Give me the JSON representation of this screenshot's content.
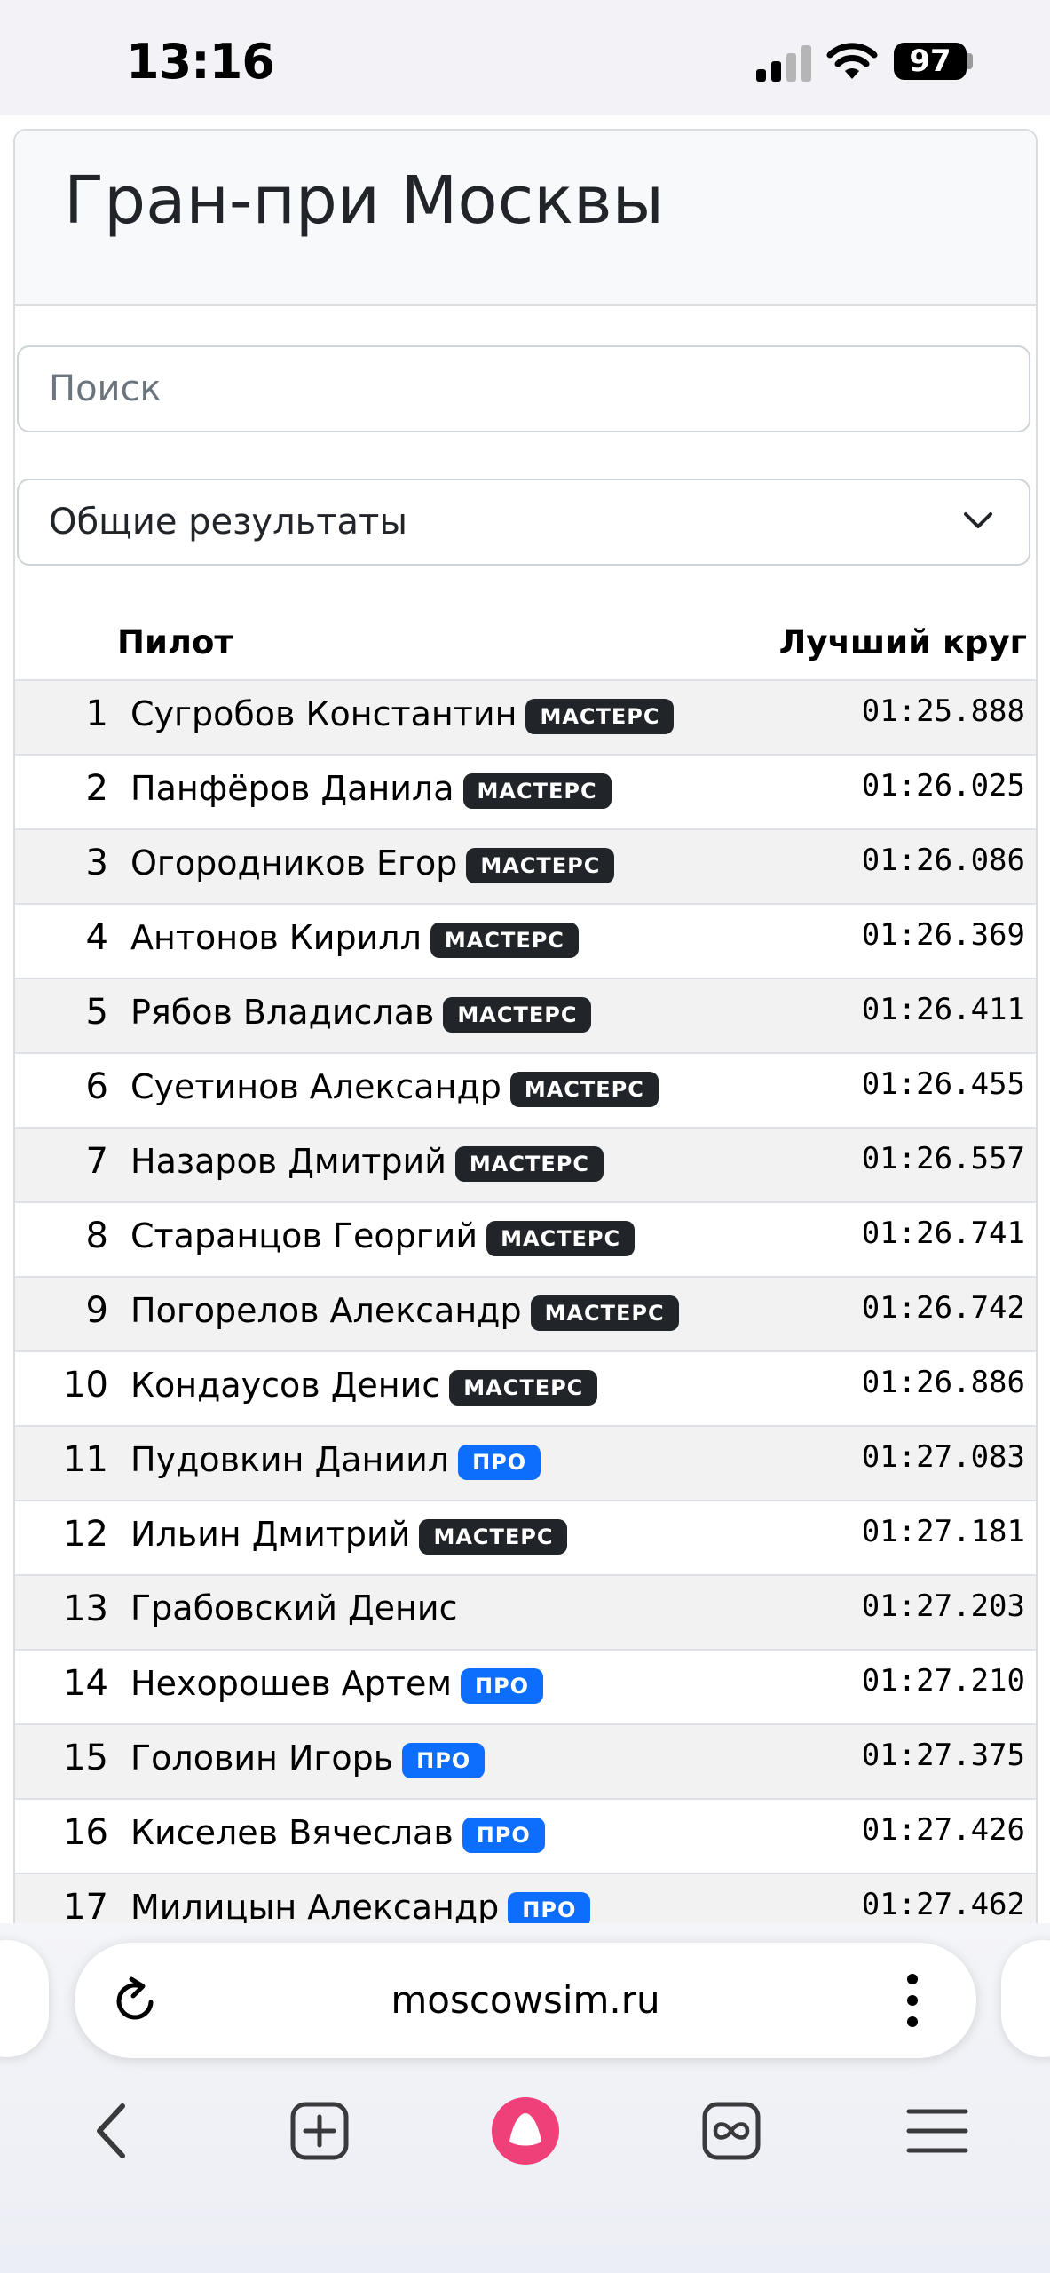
{
  "status_bar": {
    "time": "13:16",
    "battery": "97"
  },
  "page": {
    "title": "Гран-при Москвы"
  },
  "search": {
    "placeholder": "Поиск"
  },
  "filter": {
    "selected": "Общие результаты"
  },
  "table": {
    "headers": {
      "pilot": "Пилот",
      "best_lap": "Лучший круг"
    },
    "rows": [
      {
        "pos": "1",
        "name": "Сугробов Константин",
        "badge": "МАСТЕРС",
        "badge_type": "masters",
        "time": "01:25.888"
      },
      {
        "pos": "2",
        "name": "Панфёров Данила",
        "badge": "МАСТЕРС",
        "badge_type": "masters",
        "time": "01:26.025"
      },
      {
        "pos": "3",
        "name": "Огородников Егор",
        "badge": "МАСТЕРС",
        "badge_type": "masters",
        "time": "01:26.086"
      },
      {
        "pos": "4",
        "name": "Антонов Кирилл",
        "badge": "МАСТЕРС",
        "badge_type": "masters",
        "time": "01:26.369"
      },
      {
        "pos": "5",
        "name": "Рябов Владислав",
        "badge": "МАСТЕРС",
        "badge_type": "masters",
        "time": "01:26.411"
      },
      {
        "pos": "6",
        "name": "Суетинов Александр",
        "badge": "МАСТЕРС",
        "badge_type": "masters",
        "time": "01:26.455"
      },
      {
        "pos": "7",
        "name": "Назаров Дмитрий",
        "badge": "МАСТЕРС",
        "badge_type": "masters",
        "time": "01:26.557"
      },
      {
        "pos": "8",
        "name": "Старанцов Георгий",
        "badge": "МАСТЕРС",
        "badge_type": "masters",
        "time": "01:26.741"
      },
      {
        "pos": "9",
        "name": "Погорелов Александр",
        "badge": "МАСТЕРС",
        "badge_type": "masters",
        "time": "01:26.742"
      },
      {
        "pos": "10",
        "name": "Кондаусов Денис",
        "badge": "МАСТЕРС",
        "badge_type": "masters",
        "time": "01:26.886"
      },
      {
        "pos": "11",
        "name": "Пудовкин Даниил",
        "badge": "ПРО",
        "badge_type": "pro",
        "time": "01:27.083"
      },
      {
        "pos": "12",
        "name": "Ильин Дмитрий",
        "badge": "МАСТЕРС",
        "badge_type": "masters",
        "time": "01:27.181"
      },
      {
        "pos": "13",
        "name": "Грабовский Денис",
        "badge": "",
        "badge_type": "none",
        "time": "01:27.203"
      },
      {
        "pos": "14",
        "name": "Нехорошев Артем",
        "badge": "ПРО",
        "badge_type": "pro",
        "time": "01:27.210"
      },
      {
        "pos": "15",
        "name": "Головин Игорь",
        "badge": "ПРО",
        "badge_type": "pro",
        "time": "01:27.375"
      },
      {
        "pos": "16",
        "name": "Киселев Вячеслав",
        "badge": "ПРО",
        "badge_type": "pro",
        "time": "01:27.426"
      },
      {
        "pos": "17",
        "name": "Милицын Александр",
        "badge": "ПРО",
        "badge_type": "pro",
        "time": "01:27.462"
      }
    ]
  },
  "browser": {
    "url": "moscowsim.ru"
  },
  "colors": {
    "masters_badge": "#212529",
    "pro_badge": "#0d6efd",
    "alice_accent": "#f0407a"
  },
  "icons": [
    "signal-icon",
    "wifi-icon",
    "battery-icon",
    "chevron-down-icon",
    "reload-icon",
    "more-vertical-icon",
    "back-icon",
    "new-tab-icon",
    "alice-icon",
    "tabs-icon",
    "menu-icon"
  ]
}
